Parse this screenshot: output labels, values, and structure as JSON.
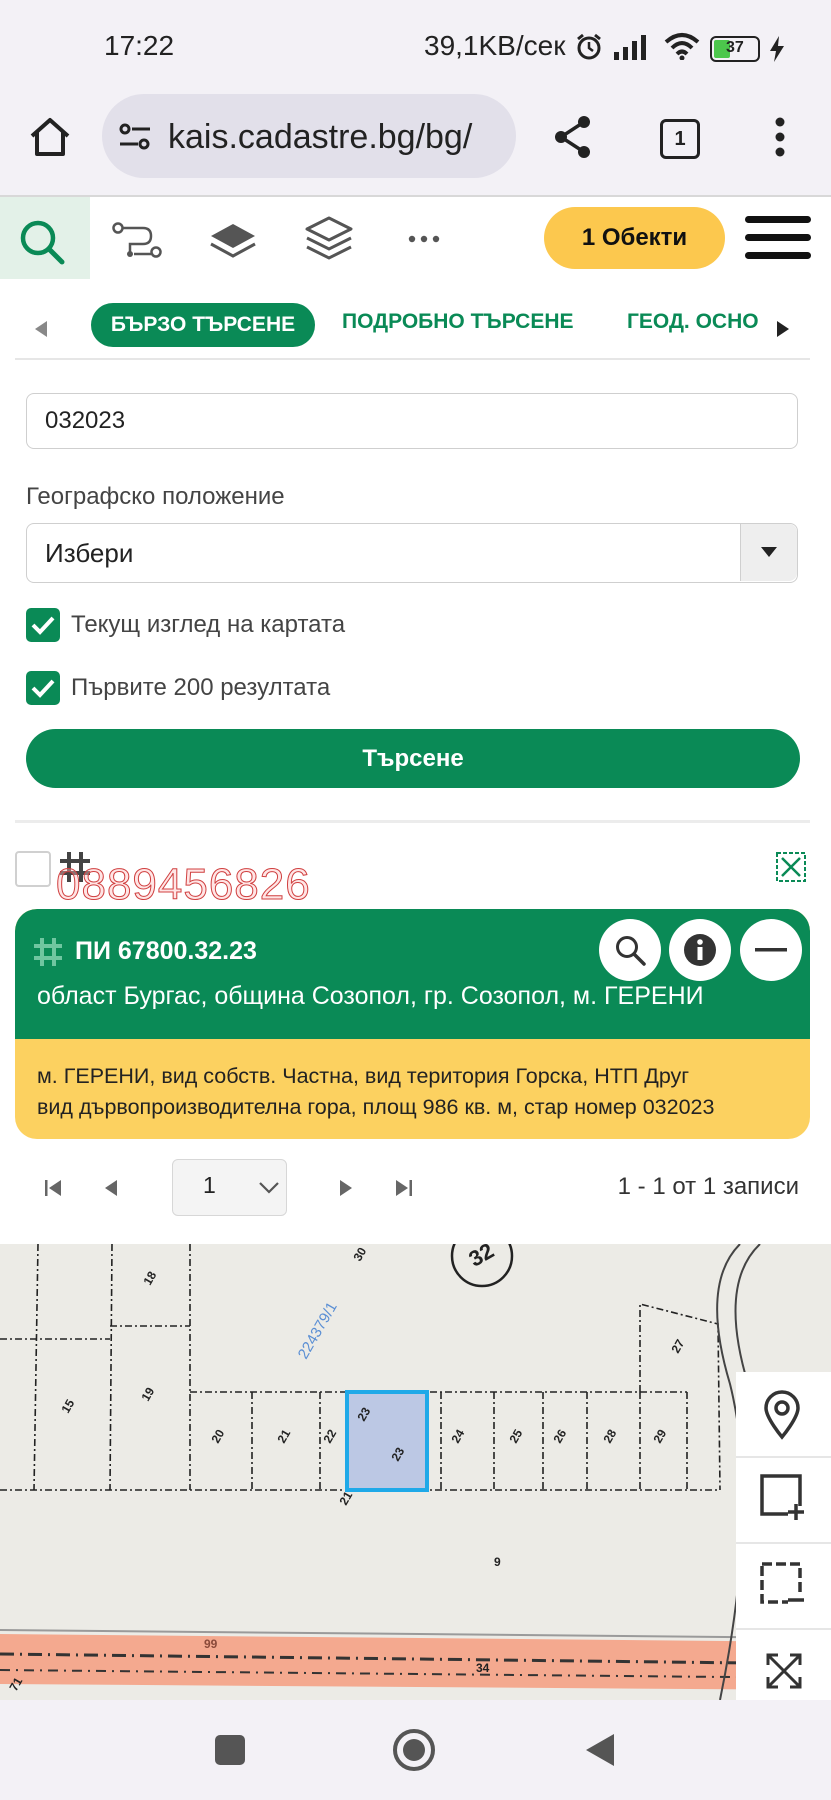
{
  "status_bar": {
    "time": "17:22",
    "network_speed": "39,1KB/сек",
    "battery": "37",
    "icons": [
      "alarm-icon",
      "signal-icon",
      "wifi-icon",
      "battery-icon",
      "charging-icon"
    ]
  },
  "browser": {
    "url": "kais.cadastre.bg/bg/",
    "tab_count": "1",
    "icons": [
      "home-icon",
      "site-settings-icon",
      "share-icon",
      "tabs-icon",
      "more-vert-icon"
    ]
  },
  "toolbar": {
    "objects_button": "1 Обекти",
    "icons": [
      "search-icon",
      "route-icon",
      "layer-icon",
      "layers-icon",
      "more-horiz-icon",
      "hamburger-menu-icon"
    ]
  },
  "tabs": {
    "items": [
      {
        "label": "БЪРЗО ТЪРСЕНЕ",
        "active": true
      },
      {
        "label": "ПОДРОБНО ТЪРСЕНЕ",
        "active": false
      },
      {
        "label": "ГЕОД. ОСНОВА",
        "active": false
      }
    ]
  },
  "form": {
    "search_value": "032023",
    "geo_label": "Географско положение",
    "geo_select_value": "Избери",
    "checkbox_current_view": "Текущ изглед на картата",
    "checkbox_first_200": "Първите 200 резултата",
    "search_button": "Търсене"
  },
  "results": {
    "watermark": "0889456826",
    "card": {
      "title": "ПИ 67800.32.23",
      "address": "област Бургас, община Созопол, гр. Созопол, м. ГЕРЕНИ",
      "description_line1": "м. ГЕРЕНИ, вид собств. Частна, вид територия Горска, НТП Друг",
      "description_line2": "вид дървопроизводителна гора, площ 986 кв. м, стар номер 032023"
    },
    "pager": {
      "page": "1",
      "info": "1 - 1 от 1 записи"
    }
  },
  "map": {
    "road_label": "224379/1",
    "section_number": "32",
    "parcels": [
      "18",
      "30",
      "15",
      "19",
      "27",
      "20",
      "21",
      "22",
      "23",
      "23",
      "24",
      "25",
      "26",
      "28",
      "29",
      "9",
      "99",
      "34",
      "21",
      "71"
    ],
    "highlight_color": "#1fa9e8",
    "road_color": "#f4a98f"
  },
  "colors": {
    "primary_green": "#0a8a56",
    "accent_yellow": "#fcc84e"
  }
}
